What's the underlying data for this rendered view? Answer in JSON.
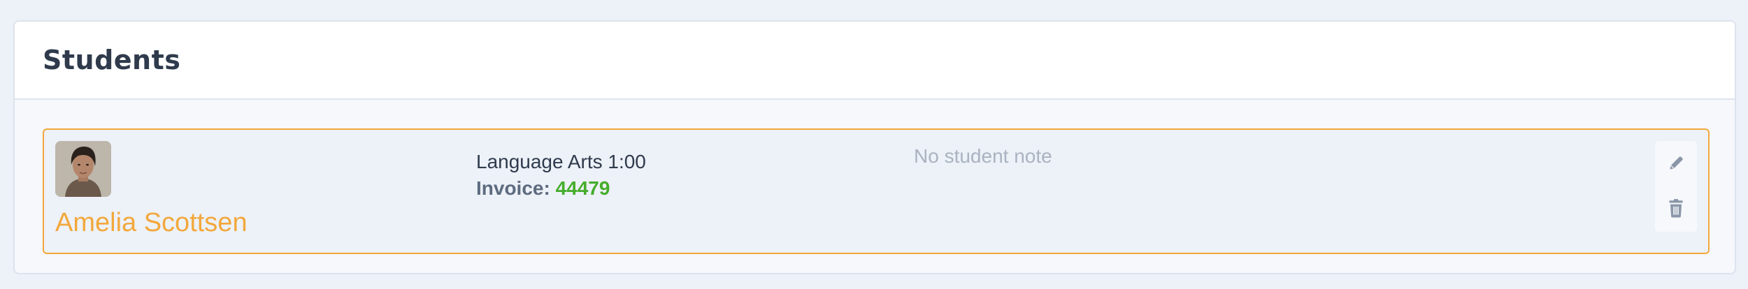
{
  "panel": {
    "title": "Students"
  },
  "students": [
    {
      "name": "Amelia Scottsen",
      "lesson": "Language Arts 1:00",
      "invoice_label": "Invoice:",
      "invoice_number": "44479",
      "note": "No student note",
      "avatar_icon": "person-photo-icon",
      "actions": {
        "edit_icon": "pencil-icon",
        "delete_icon": "trash-icon"
      }
    }
  ],
  "colors": {
    "accent": "#f2a83b",
    "invoice_number": "#46ad2c",
    "title": "#2f3b4c",
    "muted": "#aab3c0",
    "icon": "#8a96a8"
  }
}
